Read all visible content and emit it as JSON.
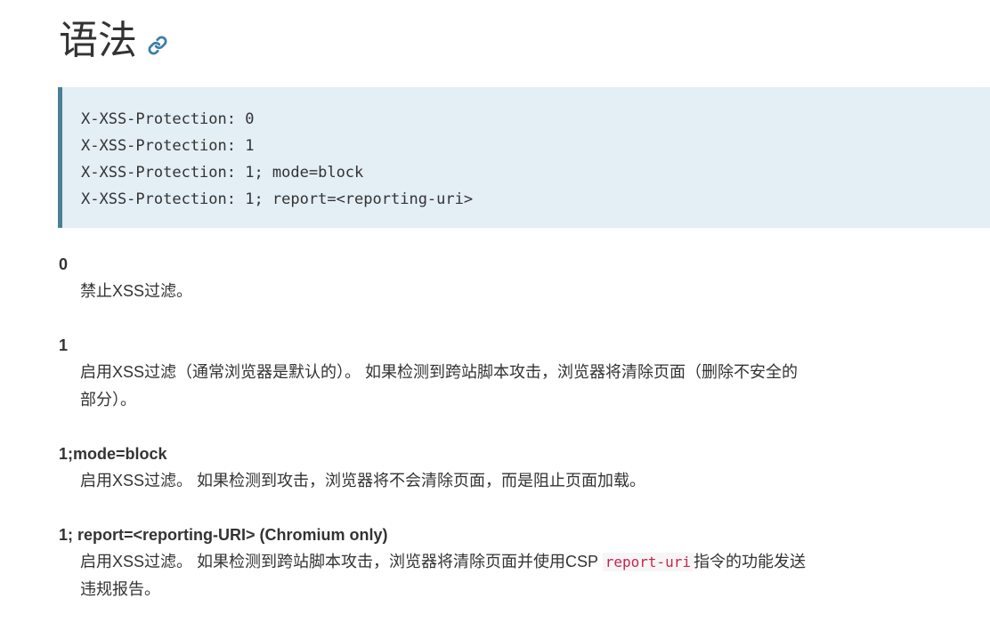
{
  "heading": {
    "title": "语法",
    "link_icon": "link-icon"
  },
  "code_block": {
    "lines": [
      "X-XSS-Protection: 0",
      "X-XSS-Protection: 1",
      "X-XSS-Protection: 1; mode=block",
      "X-XSS-Protection: 1; report=<reporting-uri>"
    ]
  },
  "definitions": [
    {
      "term": "0",
      "desc": "禁止XSS过滤。"
    },
    {
      "term": "1",
      "desc": "启用XSS过滤（通常浏览器是默认的）。 如果检测到跨站脚本攻击，浏览器将清除页面（删除不安全的部分）。"
    },
    {
      "term": "1;mode=block",
      "desc": "启用XSS过滤。 如果检测到攻击，浏览器将不会清除页面，而是阻止页面加载。"
    },
    {
      "term": "1; report=<reporting-URI>  (Chromium only)",
      "desc_before": "启用XSS过滤。 如果检测到跨站脚本攻击，浏览器将清除页面并使用CSP ",
      "desc_code": "report-uri",
      "desc_after": "指令的功能发送违规报告。"
    }
  ],
  "colors": {
    "code_bg": "#e3eef5",
    "code_border": "#4d7e95",
    "link_icon": "#3b7fa8",
    "inline_code": "#c7254e"
  }
}
